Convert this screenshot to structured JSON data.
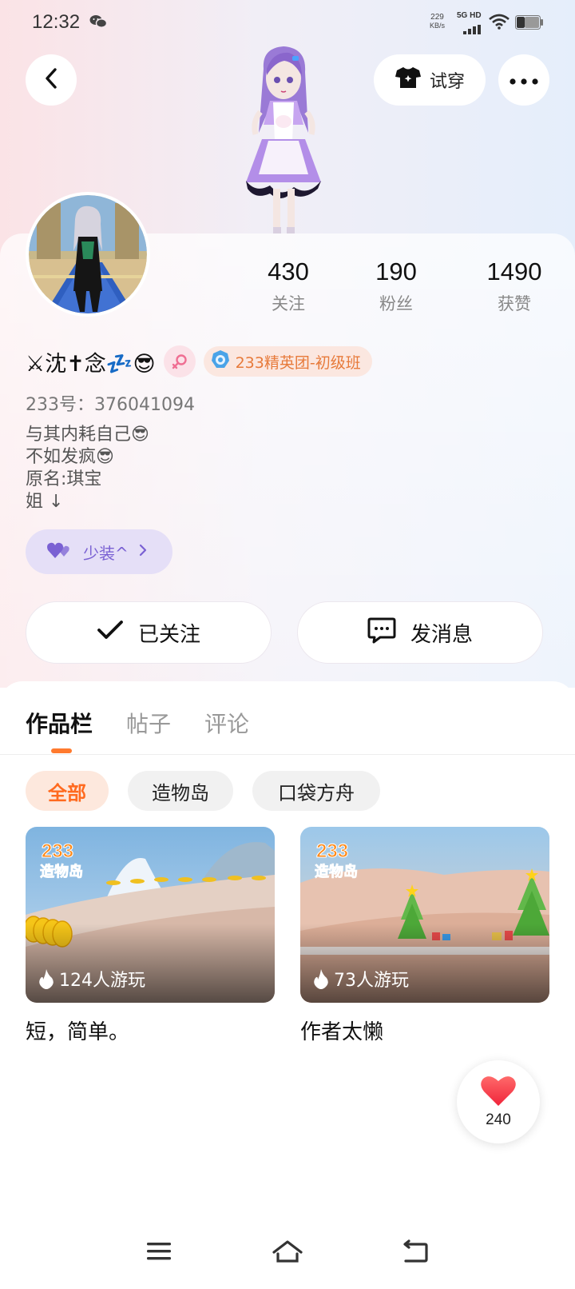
{
  "status_bar": {
    "time": "12:32",
    "net_speed": "229",
    "net_speed_unit": "KB/s",
    "network_label": "5G HD",
    "icons": [
      "wechat-icon",
      "signal-icon",
      "wifi-icon",
      "battery-icon"
    ]
  },
  "header": {
    "back_icon": "chevron-left-icon",
    "try_on_label": "试穿",
    "more_icon": "more-icon"
  },
  "stats": [
    {
      "value": "430",
      "label": "关注"
    },
    {
      "value": "190",
      "label": "粉丝"
    },
    {
      "value": "1490",
      "label": "获赞"
    }
  ],
  "profile": {
    "nickname": "⚔沈✝念💤😎",
    "gender": "female",
    "team_badge": "233精英团-初级班",
    "user_id": "233号：376041094",
    "bio_lines": [
      "与其内耗自己😎",
      "不如发疯😎",
      "原名:琪宝",
      "姐 ↓"
    ],
    "tag_label": "少装^"
  },
  "actions": {
    "follow_label": "已关注",
    "message_label": "发消息"
  },
  "tabs": [
    {
      "label": "作品栏",
      "active": true
    },
    {
      "label": "帖子",
      "active": false
    },
    {
      "label": "评论",
      "active": false
    }
  ],
  "filters": [
    {
      "label": "全部",
      "active": true
    },
    {
      "label": "造物岛",
      "active": false
    },
    {
      "label": "口袋方舟",
      "active": false
    }
  ],
  "works": [
    {
      "logo_top": "233",
      "logo_bottom": "造物岛",
      "players": "124人游玩",
      "title": "短，简单。"
    },
    {
      "logo_top": "233",
      "logo_bottom": "造物岛",
      "players": "73人游玩",
      "title": "作者太懒"
    }
  ],
  "like": {
    "count": "240"
  },
  "colors": {
    "accent": "#ff7a2e",
    "tag_purple": "#7a61d3",
    "badge_orange": "#e77a3a"
  }
}
